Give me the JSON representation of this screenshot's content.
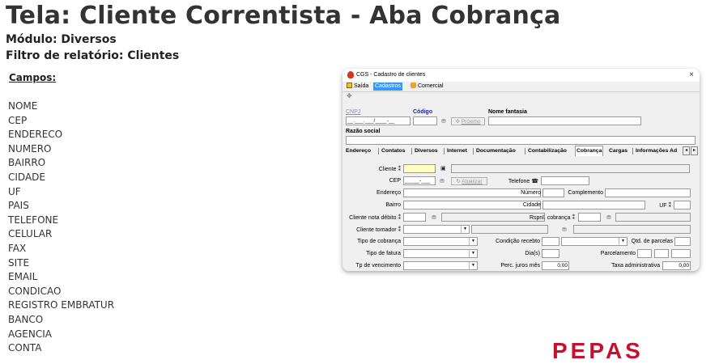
{
  "page": {
    "title": "Tela: Cliente Correntista - Aba Cobrança",
    "module": "Módulo: Diversos",
    "filter": "Filtro de relatório: Clientes",
    "fields_heading": "Campos:",
    "fields": [
      "NOME",
      "CEP",
      "ENDERECO",
      "NUMERO",
      "BAIRRO",
      "CIDADE",
      "UF",
      "PAIS",
      "TELEFONE",
      "CELULAR",
      "FAX",
      "SITE",
      "EMAIL",
      "CONDICAO",
      "REGISTRO EMBRATUR",
      "BANCO",
      "AGENCIA",
      "CONTA"
    ],
    "logo_text": "PEPAS"
  },
  "window": {
    "title": "CGS - Cadastro de clientes",
    "close": "×",
    "menu": [
      "Saída",
      "Cadastros",
      "Comercial"
    ],
    "cnpj_label": "CNPJ",
    "cnpj_value": "__.___.___/____-__",
    "codigo_label": "Código",
    "proximo_button": "Próximo",
    "nome_fantasia_label": "Nome fantasia",
    "razao_social_label": "Razão social",
    "tabs": [
      "Endereço",
      "Contatos",
      "Diversos",
      "Internet",
      "Documentação",
      "Contabilização",
      "Cobrança",
      "Cargas",
      "Informações Ad"
    ],
    "active_tab": "Cobrança",
    "form": {
      "cliente_label": "Cliente",
      "cep_label": "CEP",
      "cep_value": "_____-___",
      "atualizar_button": "Atualizar",
      "telefone_label": "Telefone",
      "endereco_label": "Endereço",
      "numero_label": "Número",
      "complemento_label": "Complemento",
      "bairro_label": "Bairro",
      "cidade_label": "Cidade",
      "uf_label": "UF",
      "cliente_nota_debito_label": "Cliente nota débito",
      "rspnl_cobranca_label": "Rspnl. cobrança",
      "cliente_tomador_label": "Cliente tomador",
      "tipo_cobranca_label": "Tipo de cobrança",
      "condicao_recebto_label": "Condição recebto",
      "qtd_parcelas_label": "Qtd. de parcelas",
      "tipo_fatura_label": "Tipo de fatura",
      "dias_label": "Dia(s)",
      "parcelamento_label": "Parcelamento",
      "tp_vencimento_label": "Tp de vencimento",
      "perc_juros_label": "Perc. juros mês",
      "perc_juros_value": "0,00",
      "taxa_administrativa_label": "Taxa administrativa",
      "taxa_administrativa_value": "0,00"
    }
  },
  "colors": {
    "menu_active": "#3399ff",
    "cliente_field": "#ffffc4",
    "logo": "#c8102e"
  }
}
